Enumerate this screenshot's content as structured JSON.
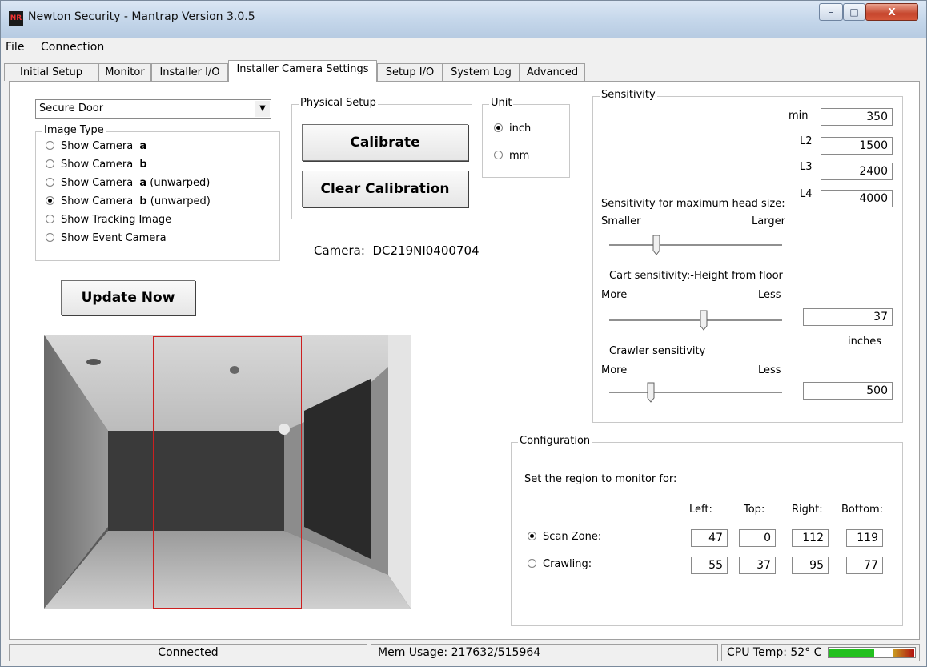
{
  "window": {
    "title": "Newton Security - Mantrap Version 3.0.5",
    "icon_text": "NR",
    "controls": {
      "minimize": "–",
      "maximize": "□",
      "close": "X"
    }
  },
  "menu": {
    "items": [
      "File",
      "Connection"
    ]
  },
  "tabs": [
    "Initial Setup",
    "Monitor",
    "Installer I/O",
    "Installer Camera Settings",
    "Setup I/O",
    "System Log",
    "Advanced"
  ],
  "active_tab": "Installer Camera Settings",
  "door_select": {
    "value": "Secure Door"
  },
  "image_type": {
    "label": "Image Type",
    "options": [
      {
        "prefix": "Show Camera ",
        "bold": "a",
        "suffix": "",
        "selected": false
      },
      {
        "prefix": "Show Camera ",
        "bold": "b",
        "suffix": "",
        "selected": false
      },
      {
        "prefix": "Show Camera ",
        "bold": "a",
        "suffix": "  (unwarped)",
        "selected": false
      },
      {
        "prefix": "Show Camera ",
        "bold": "b",
        "suffix": "  (unwarped)",
        "selected": true
      },
      {
        "prefix": "Show Tracking Image",
        "bold": "",
        "suffix": "",
        "selected": false
      },
      {
        "prefix": "Show Event Camera",
        "bold": "",
        "suffix": "",
        "selected": false
      }
    ]
  },
  "physical_setup": {
    "label": "Physical Setup",
    "calibrate": "Calibrate",
    "clear": "Clear Calibration"
  },
  "unit": {
    "label": "Unit",
    "inch": "inch",
    "mm": "mm",
    "selected": "inch"
  },
  "camera": {
    "label": "Camera:",
    "id": "DC219NI0400704"
  },
  "update_button": "Update Now",
  "sensitivity": {
    "label": "Sensitivity",
    "min_label": "min",
    "min": "350",
    "l2_label": "L2",
    "l2": "1500",
    "l3_label": "L3",
    "l3": "2400",
    "l4_label": "L4",
    "l4": "4000",
    "head_title": "Sensitivity for maximum head size:",
    "head_left": "Smaller",
    "head_right": "Larger",
    "head_level": 0.26,
    "cart_title": "Cart sensitivity:-Height from floor",
    "cart_left": "More",
    "cart_right": "Less",
    "cart_level": 0.55,
    "cart_value": "37",
    "cart_unit": "inches",
    "crawler_title": "Crawler sensitivity",
    "crawler_left": "More",
    "crawler_right": "Less",
    "crawler_level": 0.23,
    "crawler_value": "500"
  },
  "configuration": {
    "label": "Configuration",
    "prompt": "Set the region to monitor for:",
    "headers": [
      "Left:",
      "Top:",
      "Right:",
      "Bottom:"
    ],
    "rows": [
      {
        "label": "Scan Zone:",
        "selected": true,
        "values": [
          "47",
          "0",
          "112",
          "119"
        ]
      },
      {
        "label": "Crawling:",
        "selected": false,
        "values": [
          "55",
          "37",
          "95",
          "77"
        ]
      }
    ]
  },
  "status": {
    "connection": "Connected",
    "mem": "Mem Usage: 217632/515964",
    "cpu": "CPU Temp: 52° C",
    "cpu_level": 0.7
  },
  "colors": {
    "selection_rect": "#cc2020",
    "meter_green": "#22c01e",
    "meter_red": "#b01010"
  }
}
